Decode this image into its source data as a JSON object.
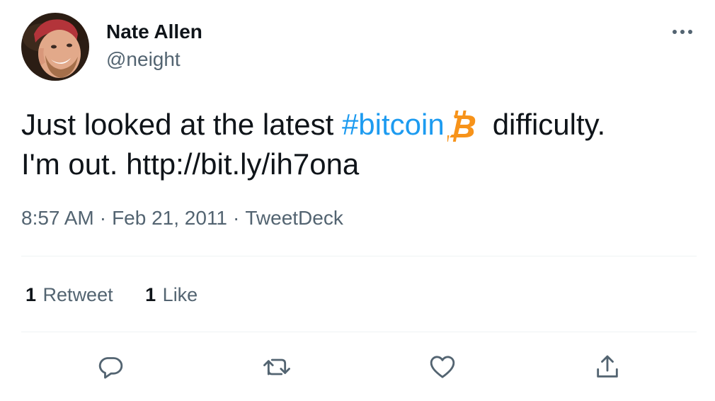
{
  "user": {
    "display_name": "Nate Allen",
    "handle": "@neight"
  },
  "tweet": {
    "text_before": "Just looked at the latest ",
    "hashtag": "#bitcoin",
    "text_after": "difficulty.",
    "line2_text": "I'm out. ",
    "link": "http://bit.ly/ih7ona",
    "emoji": "bitcoin-logo"
  },
  "meta": {
    "time": "8:57 AM",
    "separator": "·",
    "date": "Feb 21, 2011",
    "source": "TweetDeck"
  },
  "stats": {
    "retweets_count": "1",
    "retweets_label": "Retweet",
    "likes_count": "1",
    "likes_label": "Like"
  },
  "actions": {
    "reply": "reply-icon",
    "retweet": "retweet-icon",
    "like": "heart-icon",
    "share": "share-icon"
  },
  "colors": {
    "link_blue": "#1d9bf0",
    "secondary_text": "#536471",
    "bitcoin_orange": "#f7931a"
  }
}
